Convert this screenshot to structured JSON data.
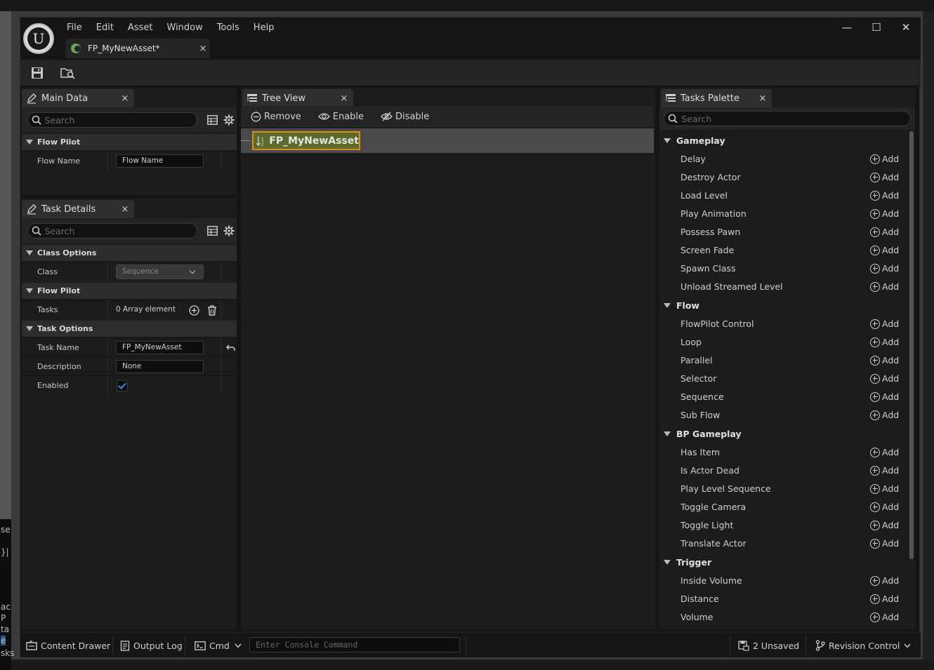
{
  "app": {
    "menu": [
      "File",
      "Edit",
      "Asset",
      "Window",
      "Tools",
      "Help"
    ],
    "logo_glyph": "U",
    "document_tab": "FP_MyNewAsset*",
    "close_glyph": "×"
  },
  "window_controls": {
    "minimize": "—",
    "maximize": "☐",
    "close": "✕"
  },
  "main_data": {
    "tab_label": "Main Data",
    "search_placeholder": "Search",
    "category": "Flow Pilot",
    "flow_name_label": "Flow Name",
    "flow_name_value": "Flow Name"
  },
  "task_details": {
    "tab_label": "Task Details",
    "search_placeholder": "Search",
    "class_options": "Class Options",
    "class_label": "Class",
    "class_value": "Sequence",
    "flow_pilot": "Flow Pilot",
    "tasks_label": "Tasks",
    "tasks_value": "0 Array element",
    "task_options": "Task Options",
    "task_name_label": "Task Name",
    "task_name_value": "FP_MyNewAsset",
    "description_label": "Description",
    "description_value": "None",
    "enabled_label": "Enabled",
    "enabled": true
  },
  "tree_view": {
    "tab_label": "Tree View",
    "remove": "Remove",
    "enable": "Enable",
    "disable": "Disable",
    "root_node": "FP_MyNewAsset"
  },
  "tasks_palette": {
    "tab_label": "Tasks Palette",
    "search_placeholder": "Search",
    "add_label": "Add",
    "categories": [
      {
        "name": "Gameplay",
        "items": [
          "Delay",
          "Destroy Actor",
          "Load Level",
          "Play Animation",
          "Possess Pawn",
          "Screen Fade",
          "Spawn Class",
          "Unload Streamed Level"
        ]
      },
      {
        "name": "Flow",
        "items": [
          "FlowPilot Control",
          "Loop",
          "Parallel",
          "Selector",
          "Sequence",
          "Sub Flow"
        ]
      },
      {
        "name": "BP Gameplay",
        "items": [
          "Has Item",
          "Is Actor Dead",
          "Play Level Sequence",
          "Toggle Camera",
          "Toggle Light",
          "Translate Actor"
        ]
      },
      {
        "name": "Trigger",
        "items": [
          "Inside Volume",
          "Distance",
          "Volume"
        ]
      }
    ]
  },
  "status_bar": {
    "content_drawer": "Content Drawer",
    "output_log": "Output Log",
    "cmd": "Cmd",
    "console_placeholder": "Enter Console Command",
    "unsaved": "2 Unsaved",
    "revision_control": "Revision Control"
  },
  "desktop_fragments": [
    "se",
    "}|",
    "ac",
    "P",
    "ta",
    "e",
    "sks"
  ],
  "colors": {
    "selected_node_fill": "#5b6b2a",
    "selected_node_border": "#e08a1a",
    "checkbox_check": "#3d8cf0"
  }
}
